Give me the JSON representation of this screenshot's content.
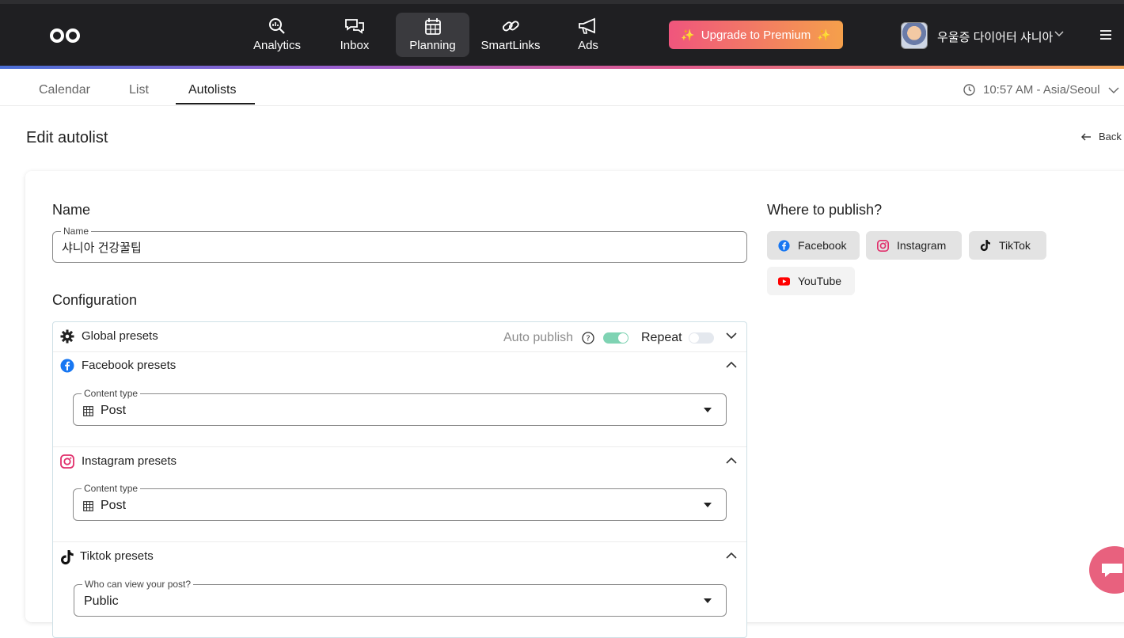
{
  "nav": {
    "items": [
      {
        "label": "Analytics",
        "icon": "analytics-icon",
        "active": false
      },
      {
        "label": "Inbox",
        "icon": "inbox-icon",
        "active": false
      },
      {
        "label": "Planning",
        "icon": "calendar-icon",
        "active": true
      },
      {
        "label": "SmartLinks",
        "icon": "link-icon",
        "active": false
      },
      {
        "label": "Ads",
        "icon": "megaphone-icon",
        "active": false
      }
    ],
    "premium_label": "Upgrade to Premium",
    "user_name": "우울증 다이어터 샤니아"
  },
  "subtabs": {
    "items": [
      "Calendar",
      "List",
      "Autolists"
    ],
    "active": "Autolists",
    "timezone": "10:57 AM - Asia/Seoul"
  },
  "page": {
    "title": "Edit autolist",
    "back_label": "Back"
  },
  "form": {
    "name_heading": "Name",
    "name_label": "Name",
    "name_value": "샤니아 건강꿀팁",
    "config_heading": "Configuration",
    "global": {
      "title": "Global presets",
      "auto_publish_label": "Auto publish",
      "auto_publish_on": true,
      "repeat_label": "Repeat",
      "repeat_on": false
    },
    "facebook": {
      "title": "Facebook presets",
      "content_type_label": "Content type",
      "content_type_value": "Post"
    },
    "instagram": {
      "title": "Instagram presets",
      "content_type_label": "Content type",
      "content_type_value": "Post"
    },
    "tiktok": {
      "title": "Tiktok presets",
      "privacy_label": "Who can view your post?",
      "privacy_value": "Public"
    }
  },
  "publish": {
    "heading": "Where to publish?",
    "platforms": [
      {
        "label": "Facebook",
        "icon": "facebook-icon",
        "selected": true
      },
      {
        "label": "Instagram",
        "icon": "instagram-icon",
        "selected": true
      },
      {
        "label": "TikTok",
        "icon": "tiktok-icon",
        "selected": true
      },
      {
        "label": "YouTube",
        "icon": "youtube-icon",
        "selected": false
      }
    ]
  },
  "colors": {
    "topbar": "#1f1f22",
    "toggle_on": "#7fd3b3",
    "toggle_off": "#e4e8ee",
    "premium_start": "#f0557d",
    "premium_end": "#f5a04b",
    "facebook": "#1877f2",
    "instagram": "#e1306c",
    "youtube": "#ff0000"
  }
}
